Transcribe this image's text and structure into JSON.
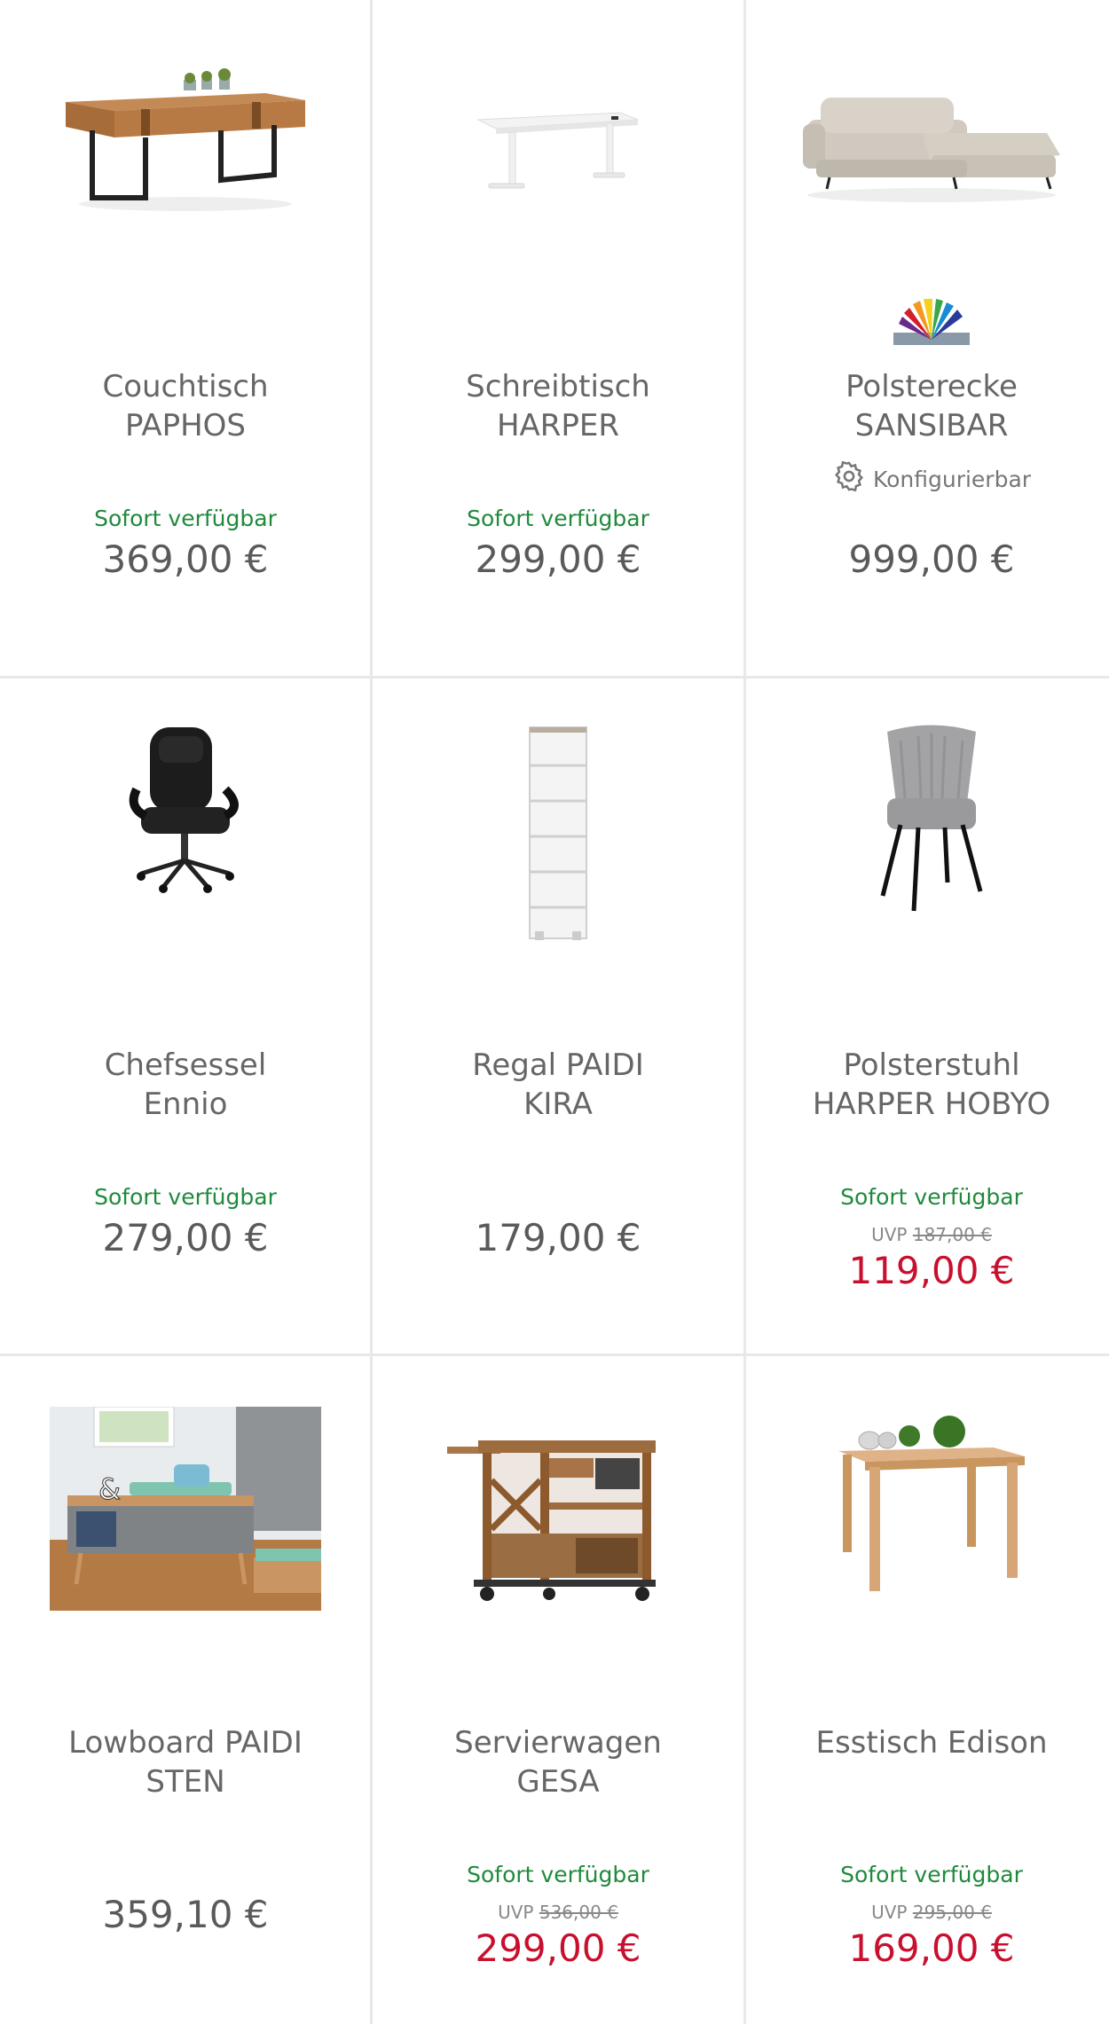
{
  "products": [
    {
      "title_line1": "Couchtisch",
      "title_line2": "PAPHOS",
      "availability": "Sofort verfügbar",
      "price": "369,00 €",
      "icon": "coffee-table-image"
    },
    {
      "title_line1": "Schreibtisch",
      "title_line2": "HARPER",
      "availability": "Sofort verfügbar",
      "price": "299,00 €",
      "icon": "desk-image"
    },
    {
      "title_line1": "Polsterecke",
      "title_line2": "SANSIBAR",
      "configurable_label": "Konfigurierbar",
      "price": "999,00 €",
      "icon": "sofa-image",
      "badge_icon": "color-fan-icon"
    },
    {
      "title_line1": "Chefsessel",
      "title_line2": "Ennio",
      "availability": "Sofort verfügbar",
      "price": "279,00 €",
      "icon": "office-chair-image"
    },
    {
      "title_line1": "Regal PAIDI",
      "title_line2": "KIRA",
      "price": "179,00 €",
      "icon": "shelf-image"
    },
    {
      "title_line1": "Polsterstuhl",
      "title_line2": "HARPER HOBYO",
      "availability": "Sofort verfügbar",
      "uvp_label": "UVP",
      "uvp_price": "187,00 €",
      "price": "119,00 €",
      "icon": "upholstered-chair-image"
    },
    {
      "title_line1": "Lowboard PAIDI",
      "title_line2": "STEN",
      "price": "359,10 €",
      "icon": "lowboard-image"
    },
    {
      "title_line1": "Servierwagen",
      "title_line2": "GESA",
      "availability": "Sofort verfügbar",
      "uvp_label": "UVP",
      "uvp_price": "536,00 €",
      "price": "299,00 €",
      "icon": "serving-cart-image"
    },
    {
      "title_line1": "Esstisch Edison",
      "availability": "Sofort verfügbar",
      "uvp_label": "UVP",
      "uvp_price": "295,00 €",
      "price": "169,00 €",
      "icon": "dining-table-image"
    }
  ],
  "colors": {
    "availability": "#1f8a3c",
    "sale_price": "#c8102e",
    "price": "#5a5a5a",
    "divider": "#e8e8e8"
  }
}
